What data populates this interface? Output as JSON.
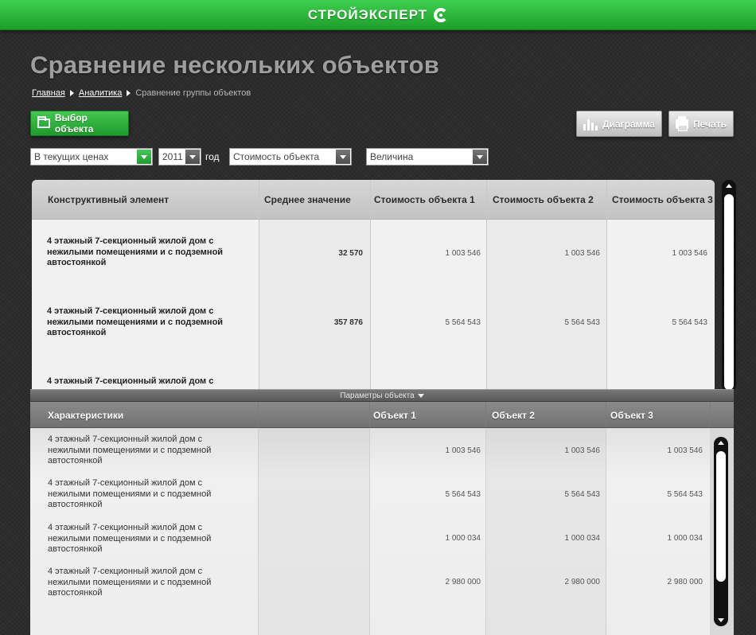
{
  "brand": {
    "name": "СТРОЙЭКСПЕРТ"
  },
  "title": "Сравнение нескольких объектов",
  "breadcrumb": {
    "home": "Главная",
    "analytics": "Аналитика",
    "current": "Сравнение группы объектов"
  },
  "toolbar": {
    "select_object": "Выбор объекта",
    "chart": "Диаграмма",
    "print": "Печать"
  },
  "filters": {
    "price": "В текущих ценах",
    "year": "2011",
    "year_label": "год",
    "metric": "Стоимость объекта",
    "unit": "Величина"
  },
  "main_table": {
    "headers": {
      "element": "Конструктивный элемент",
      "average": "Среднее значение",
      "obj1": "Стоимость объекта 1",
      "obj2": "Стоимость объекта 2",
      "obj3": "Стоимость объекта 3"
    },
    "rows": [
      {
        "name": "4 этажный 7-секционный жилой дом с нежилыми помещениями и с подземной автостоянкой",
        "avg": "32 570",
        "v1": "1 003 546",
        "v2": "1 003 546",
        "v3": "1 003 546"
      },
      {
        "name": "4 этажный 7-секционный жилой дом с нежилыми помещениями и с подземной автостоянкой",
        "avg": "357 876",
        "v1": "5 564 543",
        "v2": "5 564 543",
        "v3": "5 564 543"
      },
      {
        "name": "4 этажный 7-секционный жилой дом с",
        "avg": "",
        "v1": "",
        "v2": "",
        "v3": ""
      }
    ]
  },
  "splitter": {
    "label": "Параметры объекта"
  },
  "sub_table": {
    "headers": {
      "chars": "Характеристики",
      "obj1": "Объект 1",
      "obj2": "Объект 2",
      "obj3": "Объект 3"
    },
    "rows": [
      {
        "name": "4 этажный 7-секционный жилой дом с нежилыми помещениями и с подземной автостоянкой",
        "v1": "1 003 546",
        "v2": "1 003 546",
        "v3": "1 003 546"
      },
      {
        "name": "4 этажный 7-секционный жилой дом с нежилыми помещениями и с подземной автостоянкой",
        "v1": "5 564 543",
        "v2": "5 564 543",
        "v3": "5 564 543"
      },
      {
        "name": "4 этажный 7-секционный жилой дом с нежилыми помещениями и с подземной автостоянкой",
        "v1": "1 000 034",
        "v2": "1 000 034",
        "v3": "1 000 034"
      },
      {
        "name": "4 этажный 7-секционный жилой дом с нежилыми помещениями и с подземной автостоянкой",
        "v1": "2 980 000",
        "v2": "2 980 000",
        "v3": "2 980 000"
      }
    ]
  },
  "icons": {
    "logo": "brand-logo-icon",
    "folder": "folder-icon",
    "chart": "bar-chart-icon",
    "print": "printer-icon",
    "dropdown": "chevron-down-icon"
  },
  "colors": {
    "accent": "#2bb33a",
    "background": "#2c2c2d"
  }
}
